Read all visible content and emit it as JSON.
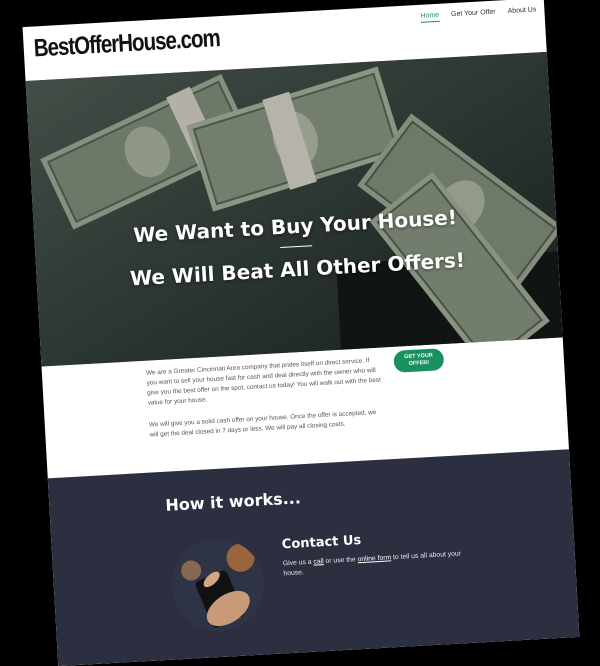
{
  "header": {
    "logo": "BestOfferHouse.com",
    "nav": [
      "Home",
      "Get Your Offer",
      "About Us"
    ]
  },
  "hero": {
    "line1": "We Want to Buy Your House!",
    "line2": "We Will Beat All Other Offers!"
  },
  "intro": {
    "p1": "We are a Greater Cincinnati Area company that prides itself on direct service. If you want to sell your house fast for cash and deal directly with the owner who will give you the best offer on the spot, contact us today! You will walk out with the best value for your house.",
    "p2": "We will give you a solid cash offer on your house. Once the offer is accepted, we will get the deal closed in 7 days or less. We will pay all closing costs."
  },
  "cta": {
    "label": "GET YOUR OFFER!"
  },
  "how": {
    "title": "How it works...",
    "step_title": "Contact Us",
    "desc_1": "Give us a ",
    "link_call": "call",
    "desc_2": " or use the ",
    "link_form": "online form",
    "desc_3": " to tell us all about your house."
  },
  "colors": {
    "accent": "#1a8f5f",
    "dark_section": "#2b2f3f"
  }
}
